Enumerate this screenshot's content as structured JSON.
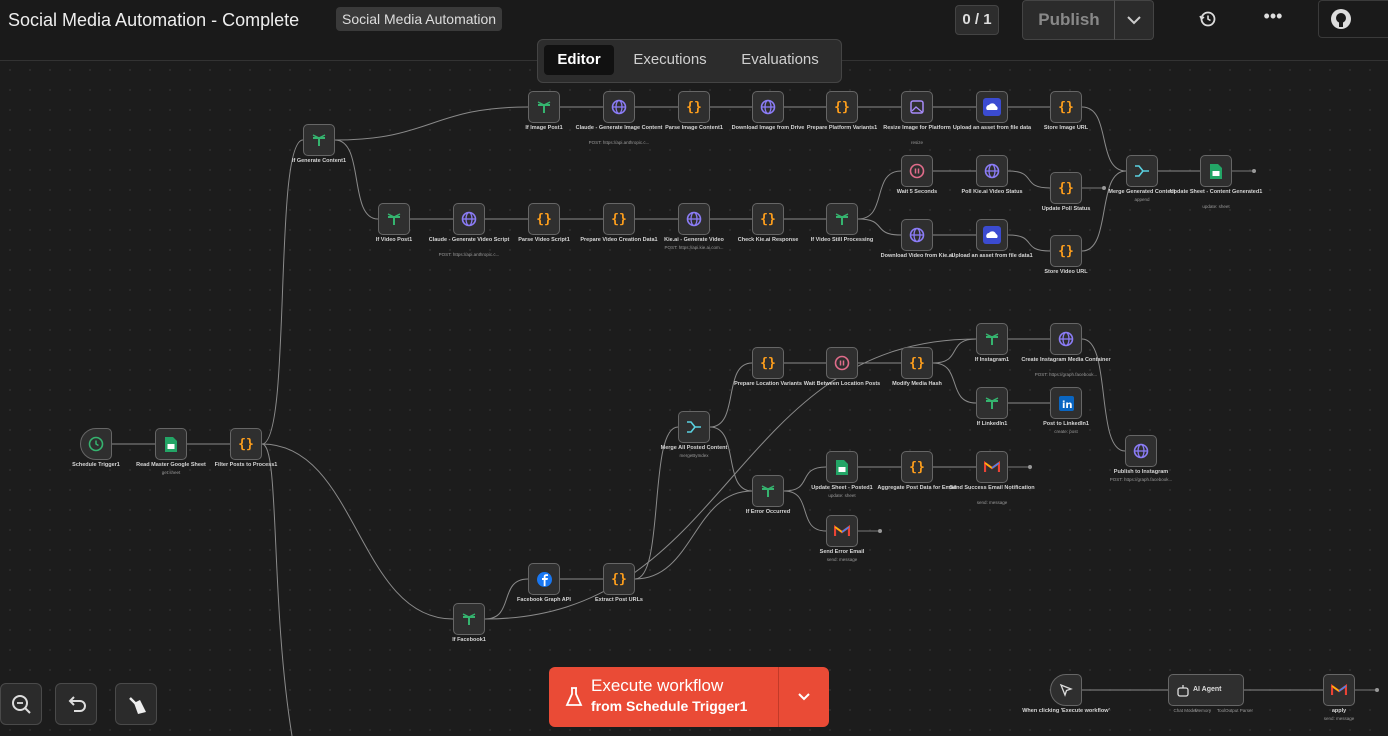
{
  "topbar": {
    "title": "Social Media Automation - Complete",
    "tag": "Social Media Automation",
    "counter": "0 / 1",
    "publish_label": "Publish",
    "github_label": ""
  },
  "tabs": [
    {
      "label": "Editor",
      "active": true
    },
    {
      "label": "Executions",
      "active": false
    },
    {
      "label": "Evaluations",
      "active": false
    }
  ],
  "nodes": {
    "schedule_trigger": {
      "label": "Schedule Trigger1"
    },
    "read_sheet": {
      "label": "Read Master Google Sheet",
      "sub": "get:sheet"
    },
    "filter_posts": {
      "label": "Filter Posts to Process1"
    },
    "if_generate": {
      "label": "If Generate Content1"
    },
    "if_image": {
      "label": "If Image Post1"
    },
    "claude_image": {
      "label": "Claude - Generate Image Content",
      "sub": "POST: https://api.anthropic.c..."
    },
    "parse_image": {
      "label": "Parse Image Content1"
    },
    "download_image": {
      "label": "Download Image from Drive"
    },
    "prepare_platform": {
      "label": "Prepare Platform Variants1"
    },
    "resize_image": {
      "label": "Resize Image for Platform",
      "sub": "resize"
    },
    "upload_asset_1": {
      "label": "Upload an asset from file data"
    },
    "store_image_url": {
      "label": "Store Image URL"
    },
    "wait_5": {
      "label": "Wait 5 Seconds"
    },
    "poll_kie": {
      "label": "Poll Kie.ai Video Status"
    },
    "update_poll": {
      "label": "Update Poll Status"
    },
    "merge_generated": {
      "label": "Merge Generated Content",
      "sub": "append"
    },
    "update_sheet_generated": {
      "label": "Update Sheet - Content Generated1",
      "sub": "update: sheet"
    },
    "if_video": {
      "label": "If Video Post1"
    },
    "claude_video": {
      "label": "Claude - Generate Video Script",
      "sub": "POST: https://api.anthropic.c..."
    },
    "parse_video": {
      "label": "Parse Video Script1"
    },
    "prepare_video": {
      "label": "Prepare Video Creation Data1"
    },
    "kie_generate": {
      "label": "Kie.ai - Generate Video",
      "sub": "POST: https://api.kie.ai.com..."
    },
    "check_kie": {
      "label": "Check Kie.ai Response"
    },
    "if_video_processing": {
      "label": "If Video Still Processing"
    },
    "download_video": {
      "label": "Download Video from Kie.ai"
    },
    "upload_asset_2": {
      "label": "Upload an asset from file data1"
    },
    "store_video_url": {
      "label": "Store Video URL"
    },
    "if_instagram": {
      "label": "If Instagram1"
    },
    "create_ig_container": {
      "label": "Create Instagram Media Container",
      "sub": "POST: https://graph.facebook..."
    },
    "if_linkedin": {
      "label": "If LinkedIn1"
    },
    "post_linkedin": {
      "label": "Post to LinkedIn1",
      "sub": "create: post"
    },
    "publish_instagram": {
      "label": "Publish to Instagram",
      "sub": "POST: https://graph.facebook..."
    },
    "prepare_location": {
      "label": "Prepare Location Variants"
    },
    "wait_between": {
      "label": "Wait Between Location Posts"
    },
    "modify_hash": {
      "label": "Modify Media Hash"
    },
    "merge_posted": {
      "label": "Merge All Posted Content",
      "sub": "mergeByIndex"
    },
    "update_posted": {
      "label": "Update Sheet - Posted1",
      "sub": "update: sheet"
    },
    "aggregate": {
      "label": "Aggregate Post Data for Email"
    },
    "send_success": {
      "label": "Send Success Email Notification",
      "sub": "send: message"
    },
    "if_error": {
      "label": "If Error Occurred"
    },
    "send_error": {
      "label": "Send Error Email",
      "sub": "send: message"
    },
    "facebook_api": {
      "label": "Facebook Graph API"
    },
    "extract_urls": {
      "label": "Extract Post URLs"
    },
    "if_facebook": {
      "label": "If Facebook1"
    },
    "manual_trigger": {
      "label": "When clicking 'Execute workflow'"
    },
    "ai_agent": {
      "label": "AI Agent",
      "ports": [
        "Chat Model",
        "Memory",
        "Tool",
        "Output Parser"
      ]
    },
    "apply": {
      "label": "apply",
      "sub": "send: message"
    }
  },
  "execute": {
    "label": "Execute workflow",
    "sub": "from Schedule Trigger1"
  },
  "colors": {
    "accent": "#ea4b36",
    "if_green": "#35b46f",
    "code_orange": "#ff9f1c",
    "http_purple": "#8b7cf6",
    "wait_pink": "#e06c8a"
  }
}
